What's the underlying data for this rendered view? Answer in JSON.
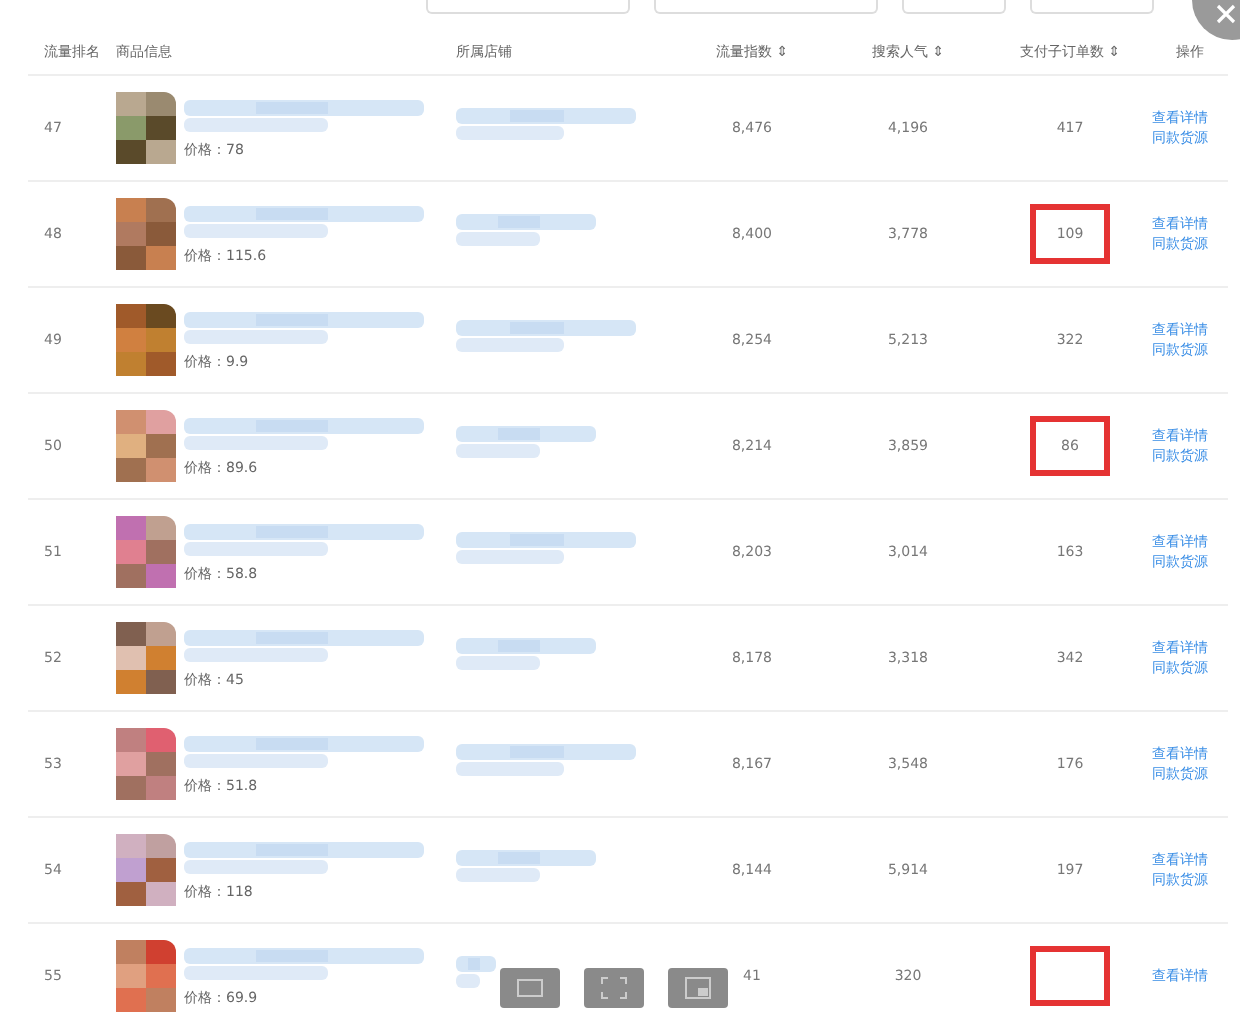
{
  "columns": [
    "流量排名",
    "商品信息",
    "所属店铺",
    "流量指数 ⇕",
    "搜索人气 ⇕",
    "支付子订单数 ⇕",
    "操作"
  ],
  "rows": [
    {
      "rank": "47",
      "price": "价格：78",
      "flow": "8,476",
      "search": "4,196",
      "orders": "417",
      "highlighted": false,
      "links": [
        "查看详情",
        "同款货源"
      ]
    },
    {
      "rank": "48",
      "price": "价格：115.6",
      "flow": "8,400",
      "search": "3,778",
      "orders": "109",
      "highlighted": true,
      "links": [
        "查看详情",
        "同款货源"
      ]
    },
    {
      "rank": "49",
      "price": "价格：9.9",
      "flow": "8,254",
      "search": "5,213",
      "orders": "322",
      "highlighted": false,
      "links": [
        "查看详情",
        "同款货源"
      ]
    },
    {
      "rank": "50",
      "price": "价格：89.6",
      "flow": "8,214",
      "search": "3,859",
      "orders": "86",
      "highlighted": true,
      "links": [
        "查看详情",
        "同款货源"
      ]
    },
    {
      "rank": "51",
      "price": "价格：58.8",
      "flow": "8,203",
      "search": "3,014",
      "orders": "163",
      "highlighted": false,
      "links": [
        "查看详情",
        "同款货源"
      ]
    },
    {
      "rank": "52",
      "price": "价格：45",
      "flow": "8,178",
      "search": "3,318",
      "orders": "342",
      "highlighted": false,
      "links": [
        "查看详情",
        "同款货源"
      ]
    },
    {
      "rank": "53",
      "price": "价格：51.8",
      "flow": "8,167",
      "search": "3,548",
      "orders": "176",
      "highlighted": false,
      "links": [
        "查看详情",
        "同款货源"
      ]
    },
    {
      "rank": "54",
      "price": "价格：118",
      "flow": "8,144",
      "search": "5,914",
      "orders": "197",
      "highlighted": false,
      "links": [
        "查看详情",
        "同款货源"
      ]
    },
    {
      "rank": "55",
      "price": "价格：69.9",
      "flow": "41",
      "search": "320",
      "orders": "",
      "highlighted": true,
      "links": [
        "查看详情"
      ]
    }
  ]
}
